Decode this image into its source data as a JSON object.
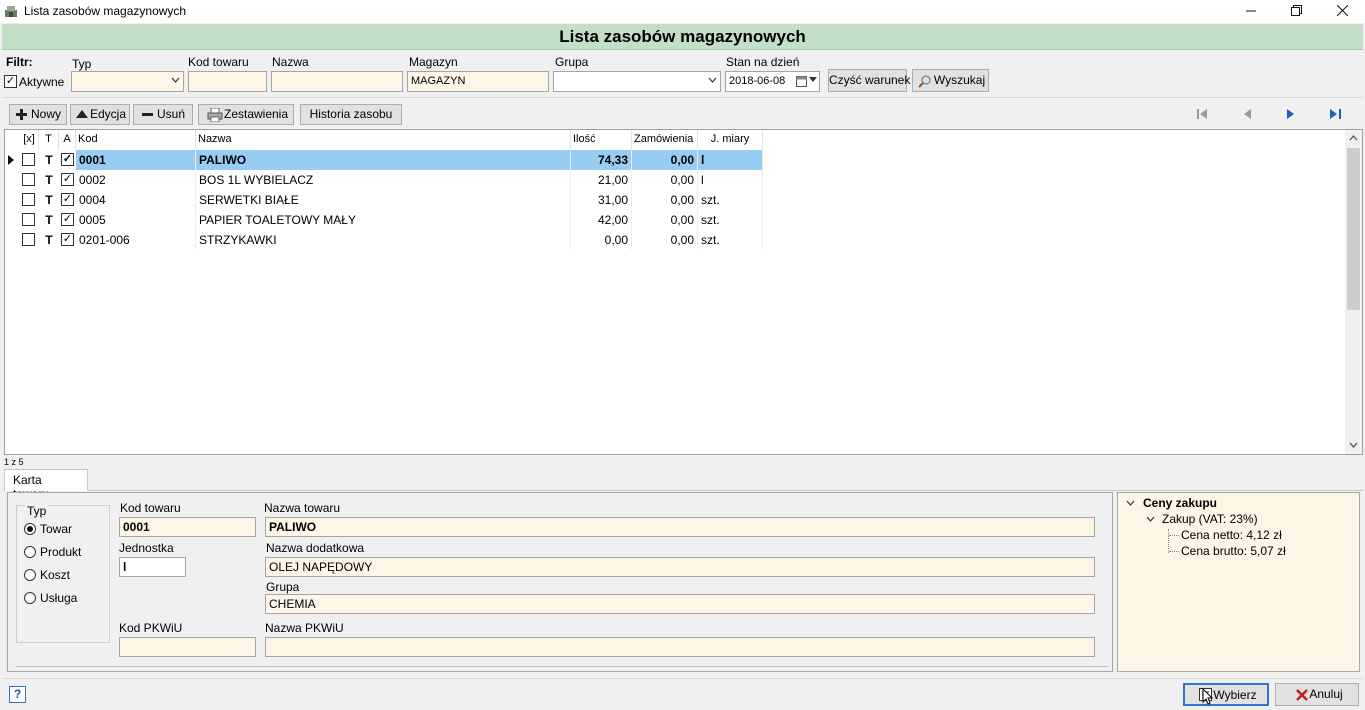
{
  "window": {
    "title": "Lista zasobów magazynowych",
    "banner_title": "Lista zasobów magazynowych",
    "minimize_icon": "minimize-icon",
    "restore_icon": "restore-icon",
    "close_icon": "close-icon"
  },
  "filter": {
    "label": "Filtr:",
    "aktywne_label": "Aktywne",
    "aktywne_checked": true,
    "typ_label": "Typ",
    "typ_value": "",
    "kod_label": "Kod towaru",
    "kod_value": "",
    "nazwa_label": "Nazwa",
    "nazwa_value": "",
    "magazyn_label": "Magazyn",
    "magazyn_value": "MAGAZYN",
    "grupa_label": "Grupa",
    "grupa_value": "",
    "stan_label": "Stan na dzień",
    "stan_value": "2018-06-08",
    "clear_button": "Czyść warunek",
    "search_button": "Wyszukaj"
  },
  "toolbar": {
    "new_button": "Nowy",
    "edit_button": "Edycja",
    "delete_button": "Usuń",
    "reports_button": "Zestawienia",
    "history_button": "Historia zasobu"
  },
  "grid": {
    "columns": [
      "[x]",
      "T",
      "A",
      "Kod",
      "Nazwa",
      "Ilość",
      "Zamówienia",
      "J. miary"
    ],
    "rows": [
      {
        "x": false,
        "t": "T",
        "a": true,
        "kod": "0001",
        "nazwa": "PALIWO",
        "ilosc": "74,33",
        "zamowienia": "0,00",
        "jm": "l",
        "selected": true
      },
      {
        "x": false,
        "t": "T",
        "a": true,
        "kod": "0002",
        "nazwa": "BOS 1L WYBIELACZ",
        "ilosc": "21,00",
        "zamowienia": "0,00",
        "jm": "l",
        "selected": false
      },
      {
        "x": false,
        "t": "T",
        "a": true,
        "kod": "0004",
        "nazwa": "SERWETKI BIAŁE",
        "ilosc": "31,00",
        "zamowienia": "0,00",
        "jm": "szt.",
        "selected": false
      },
      {
        "x": false,
        "t": "T",
        "a": true,
        "kod": "0005",
        "nazwa": "PAPIER TOALETOWY MAŁY",
        "ilosc": "42,00",
        "zamowienia": "0,00",
        "jm": "szt.",
        "selected": false
      },
      {
        "x": false,
        "t": "T",
        "a": true,
        "kod": "0201-006",
        "nazwa": "STRZYKAWKI",
        "ilosc": "0,00",
        "zamowienia": "0,00",
        "jm": "szt.",
        "selected": false
      }
    ],
    "record_count": "1 z 5"
  },
  "card": {
    "tab_label": "Karta towaru",
    "typ_label": "Typ",
    "typ_options": [
      "Towar",
      "Produkt",
      "Koszt",
      "Usługa"
    ],
    "typ_selected": "Towar",
    "kod_label": "Kod towaru",
    "kod_value": "0001",
    "nazwa_label": "Nazwa towaru",
    "nazwa_value": "PALIWO",
    "jednostka_label": "Jednostka",
    "jednostka_value": "l",
    "nazwa_dod_label": "Nazwa dodatkowa",
    "nazwa_dod_value": "OLEJ NAPĘDOWY",
    "grupa_label": "Grupa",
    "grupa_value": "CHEMIA",
    "pkwiu_label": "Kod PKWiU",
    "pkwiu_value": "",
    "nazwa_pkwiu_label": "Nazwa PKWiU",
    "nazwa_pkwiu_value": ""
  },
  "prices": {
    "root": "Ceny zakupu",
    "child": "Zakup (VAT: 23%)",
    "netto": "Cena netto: 4,12 zł",
    "brutto": "Cena brutto: 5,07 zł"
  },
  "footer": {
    "help": "?",
    "select_button": "Wybierz",
    "cancel_button": "Anuluj"
  }
}
